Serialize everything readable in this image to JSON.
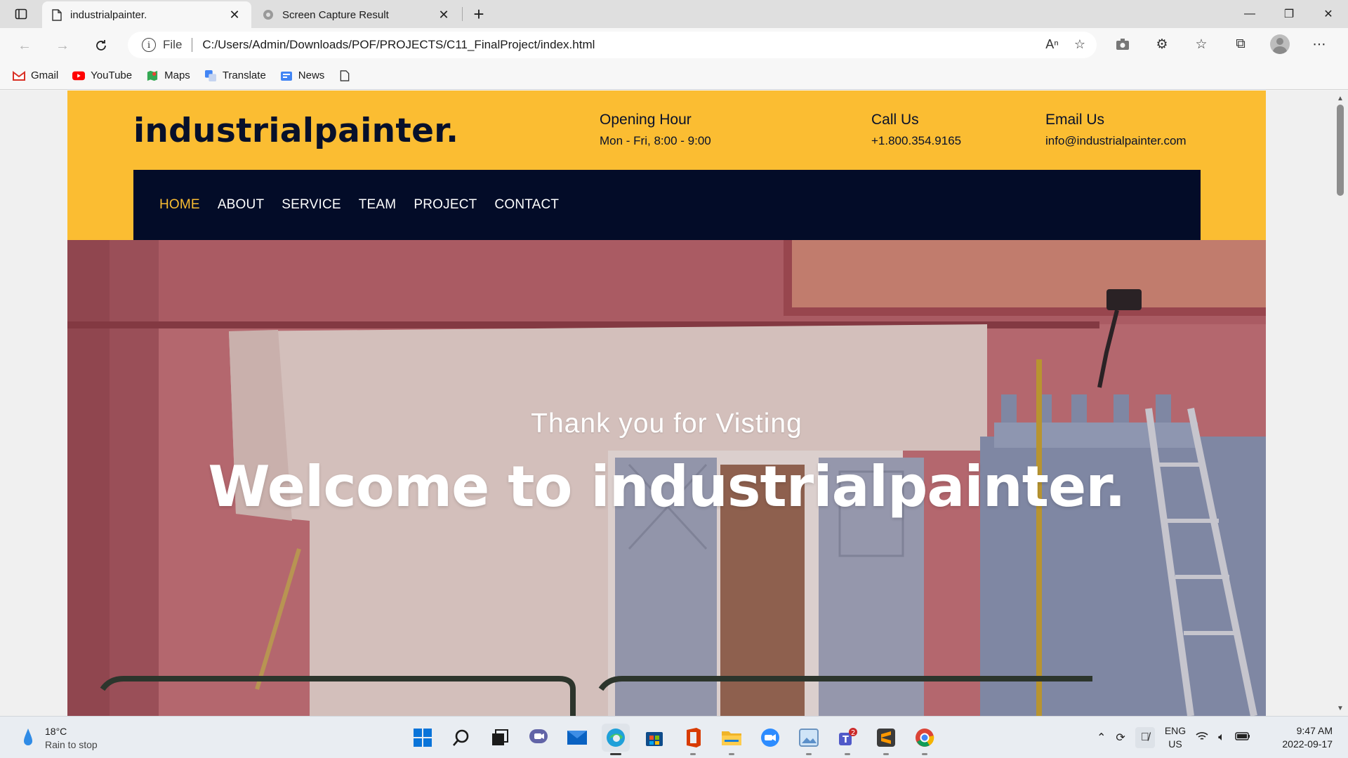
{
  "browser": {
    "tabs": [
      {
        "title": "industrialpainter.",
        "active": true
      },
      {
        "title": "Screen Capture Result",
        "active": false
      }
    ],
    "address": {
      "scheme": "File",
      "url": "C:/Users/Admin/Downloads/POF/PROJECTS/C11_FinalProject/index.html"
    },
    "bookmarks": [
      "Gmail",
      "YouTube",
      "Maps",
      "Translate",
      "News"
    ]
  },
  "site": {
    "brand": "industrialpainter.",
    "info": [
      {
        "title": "Opening Hour",
        "value": "Mon - Fri, 8:00 - 9:00"
      },
      {
        "title": "Call Us",
        "value": "+1.800.354.9165"
      },
      {
        "title": "Email Us",
        "value": "info@industrialpainter.com"
      }
    ],
    "nav": [
      "HOME",
      "ABOUT",
      "SERVICE",
      "TEAM",
      "PROJECT",
      "CONTACT"
    ],
    "hero": {
      "subtitle": "Thank you for Visting",
      "title": "Welcome to industrialpainter."
    },
    "colors": {
      "accent": "#fbbd32",
      "navy": "#030c28"
    }
  },
  "taskbar": {
    "weather": {
      "temp": "18°C",
      "desc": "Rain to stop"
    },
    "lang": {
      "line1": "ENG",
      "line2": "US"
    },
    "clock": {
      "time": "9:47 AM",
      "date": "2022-09-17"
    },
    "teams_badge": "2"
  }
}
